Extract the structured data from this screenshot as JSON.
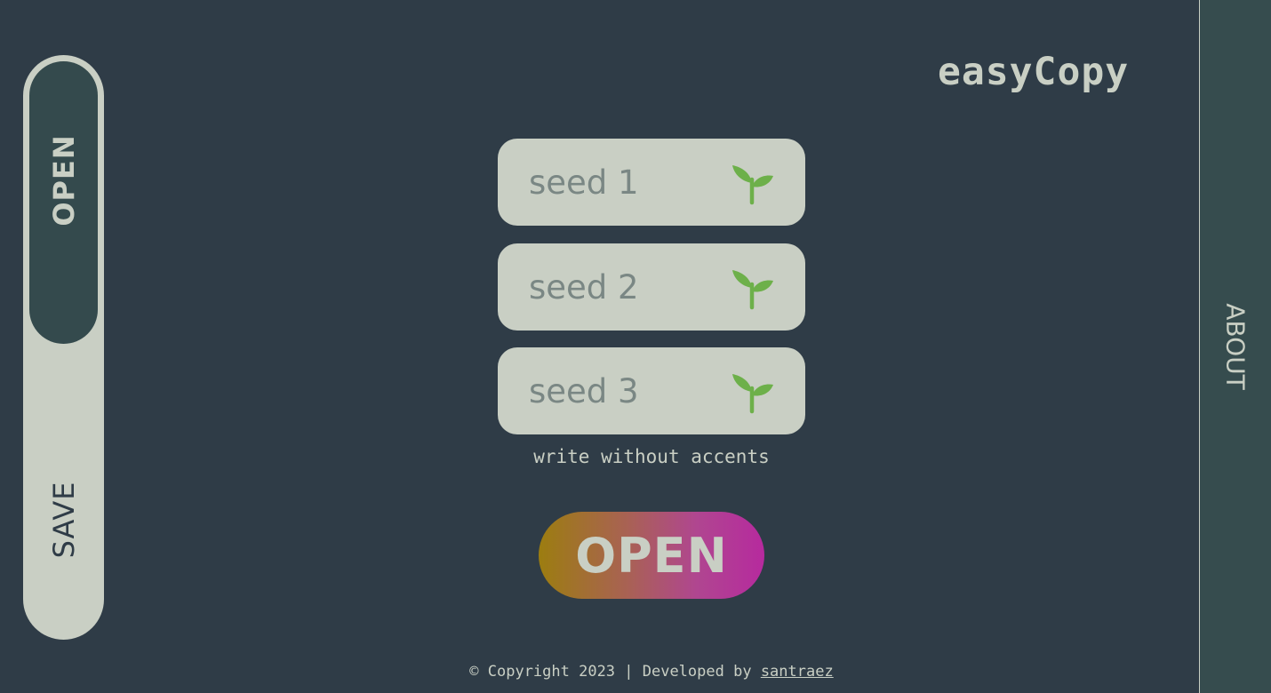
{
  "logo": "easyCopy",
  "mode_toggle": {
    "open_label": "OPEN",
    "save_label": "SAVE",
    "active": "OPEN"
  },
  "about_label": "ABOUT",
  "seeds": [
    {
      "placeholder": "seed 1",
      "icon": "sprout-icon"
    },
    {
      "placeholder": "seed 2",
      "icon": "sprout-icon"
    },
    {
      "placeholder": "seed 3",
      "icon": "sprout-icon"
    }
  ],
  "hint": "write without accents",
  "open_button_label": "OPEN",
  "footer": {
    "text": "© Copyright 2023 | Developed by",
    "author_link": "santraez"
  },
  "colors": {
    "background": "#2f3c47",
    "panel": "#364c4e",
    "light": "#c9cfc4",
    "sprout": "#6db04a",
    "button_gradient": [
      "#9c7d10",
      "#b62a9e"
    ]
  }
}
